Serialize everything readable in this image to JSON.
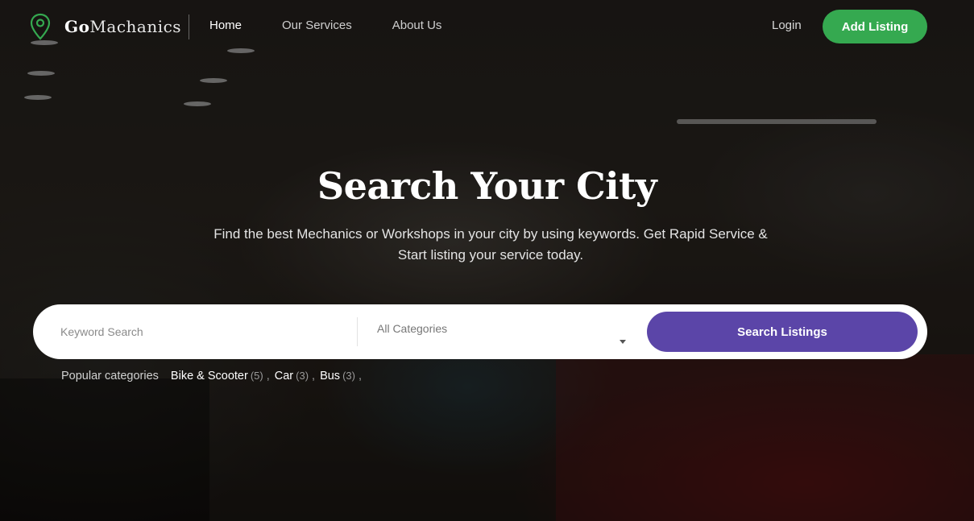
{
  "brand": {
    "name_bold": "Go",
    "name_rest": "Machanics"
  },
  "nav": {
    "items": [
      {
        "label": "Home",
        "active": true
      },
      {
        "label": "Our Services",
        "active": false
      },
      {
        "label": "About Us",
        "active": false
      }
    ],
    "login_label": "Login",
    "add_listing_label": "Add Listing"
  },
  "hero": {
    "title": "Search Your City",
    "subtitle": "Find the best Mechanics or Workshops in your city by using keywords. Get Rapid Service & Start listing your service today."
  },
  "search": {
    "keyword_placeholder": "Keyword Search",
    "category_value": "All Categories",
    "button_label": "Search Listings"
  },
  "popular": {
    "label": "Popular categories",
    "items": [
      {
        "name": "Bike & Scooter",
        "count": "(5)"
      },
      {
        "name": "Car",
        "count": "(3)"
      },
      {
        "name": "Bus",
        "count": "(3)"
      }
    ]
  },
  "colors": {
    "accent_green": "#35a950",
    "accent_purple": "#5b45a8"
  },
  "icons": {
    "logo": "map-pin-icon",
    "select_caret": "caret-down-icon"
  }
}
